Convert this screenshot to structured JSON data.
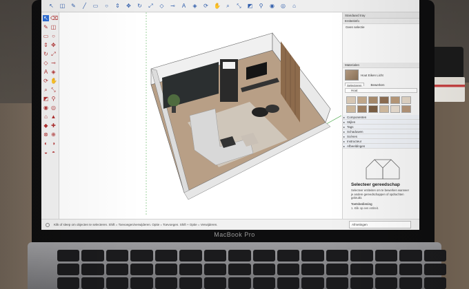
{
  "app": {
    "brand_label": "MacBook Pro"
  },
  "toolbar": {
    "icons": [
      "select-icon",
      "eraser-icon",
      "pencil-icon",
      "line-icon",
      "rectangle-icon",
      "circle-icon",
      "pushpull-icon",
      "move-icon",
      "rotate-icon",
      "scale-icon",
      "offset-icon",
      "tape-icon",
      "text-icon",
      "paint-icon",
      "orbit-icon",
      "pan-icon",
      "zoom-icon",
      "zoom-extents-icon",
      "section-icon",
      "walk-icon",
      "position-camera-icon",
      "look-around-icon",
      "warehouse-icon"
    ]
  },
  "tray": {
    "title": "Standaard tray",
    "entity_section": "Entiteitinfo",
    "no_selection": "Geen selectie",
    "materials_section": "Materialen",
    "material_name": "Hout Eiken Licht",
    "tab_select": "Selecteren",
    "tab_edit": "Bewerken",
    "search_label": "Hout",
    "swatches": [
      "#d9c9b6",
      "#c3a98c",
      "#a88b6d",
      "#8d6e52",
      "#b99a7a",
      "#e3d6c6",
      "#cdb89e",
      "#9f8063",
      "#7a5e45",
      "#d2bca0",
      "#e8ddd0",
      "#b49478"
    ],
    "collapsed_sections": [
      "Componenten",
      "Stijlen",
      "Tags",
      "Schaduwen",
      "Scènes",
      "Instructeur",
      "Afbeeldingen"
    ],
    "select_tool_title": "Selecteer gereedschap",
    "select_tool_desc": "Selecteer entiteiten om te bewerken wanneer je andere gereedschappen of opdrachten gebruikt.",
    "shortcuts_label": "Toetsbediening",
    "shortcut_hint": "1. Klik op een entiteit."
  },
  "viewport": {
    "value_box_label": "Afmetingen"
  },
  "status": {
    "message": "Klik of sleep om objecten te selecteren. Shift = Toevoegen/verwijderen. Optie = Toevoegen. Shift + Optie = Verwijderen."
  }
}
